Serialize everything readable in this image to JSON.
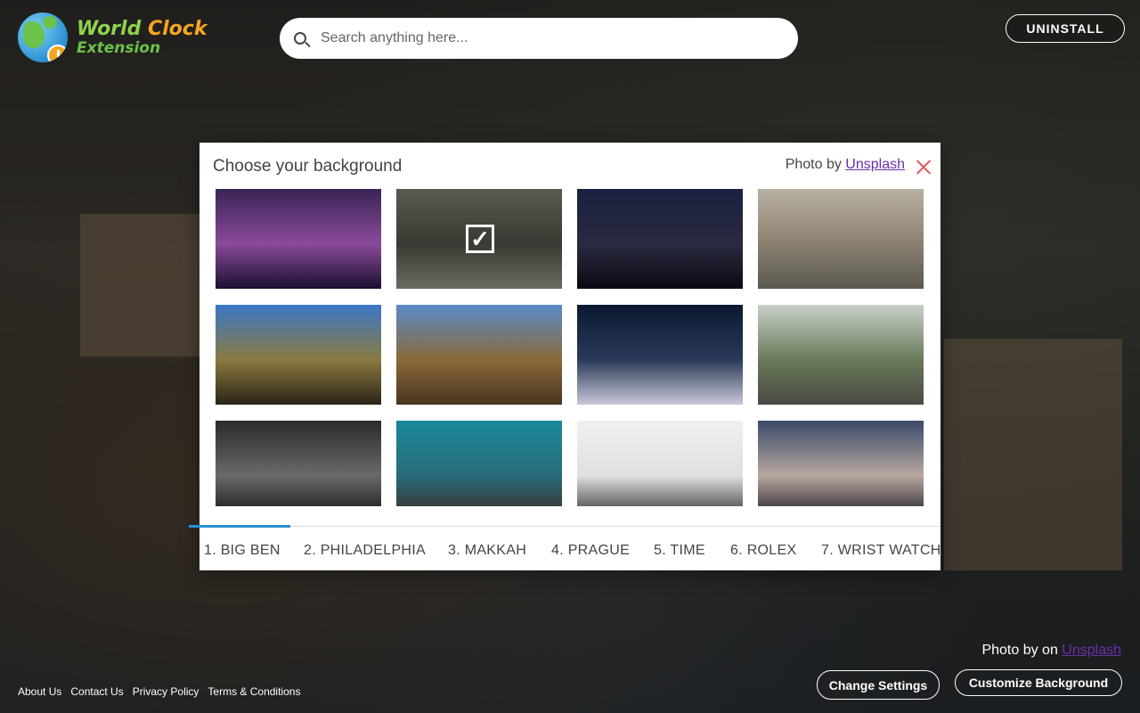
{
  "logo": {
    "line1_a": "World ",
    "line1_b": "Clock",
    "line2": "Extension"
  },
  "search": {
    "placeholder": "Search anything here..."
  },
  "header": {
    "uninstall_label": "UNINSTALL"
  },
  "modal": {
    "title": "Choose your background",
    "photo_by": "Photo by ",
    "photo_source": "Unsplash",
    "selected_index": 1,
    "thumbnails": [
      {
        "colors": [
          "#3a2456",
          "#8a4a9a",
          "#1a1030"
        ]
      },
      {
        "colors": [
          "#5a5a50",
          "#3a3a34",
          "#6a6a60"
        ]
      },
      {
        "colors": [
          "#1a2040",
          "#2a2a40",
          "#0a0a14"
        ]
      },
      {
        "colors": [
          "#b8b0a0",
          "#8a8070",
          "#5a5850"
        ]
      },
      {
        "colors": [
          "#3a78c8",
          "#8a7a40",
          "#2a2418"
        ]
      },
      {
        "colors": [
          "#5a8ac8",
          "#8a6a3a",
          "#4a3420"
        ]
      },
      {
        "colors": [
          "#0a1830",
          "#2a3a58",
          "#c8c8d8"
        ]
      },
      {
        "colors": [
          "#c8d0c8",
          "#6a7a5a",
          "#4a4a44"
        ]
      },
      {
        "colors": [
          "#2a2a2a",
          "#6a6a6a",
          "#111111"
        ]
      },
      {
        "colors": [
          "#1a8a9a",
          "#2a6a7a",
          "#3a2a20"
        ]
      },
      {
        "colors": [
          "#f0f0f0",
          "#e0e0e0",
          "#2a2a2a"
        ]
      },
      {
        "colors": [
          "#3a4a6a",
          "#b8a8a0",
          "#1a1820"
        ]
      }
    ],
    "tabs": [
      {
        "label": "1. BIG BEN"
      },
      {
        "label": "2. PHILADELPHIA"
      },
      {
        "label": "3. MAKKAH"
      },
      {
        "label": "4. PRAGUE"
      },
      {
        "label": "5. TIME"
      },
      {
        "label": "6. ROLEX"
      },
      {
        "label": "7. WRIST WATCH"
      }
    ]
  },
  "bottom": {
    "photo_by": "Photo by on ",
    "photo_source": "Unsplash",
    "change_settings": "Change Settings",
    "customize_background": "Customize Background"
  },
  "footer": {
    "links": [
      "About Us",
      "Contact Us",
      "Privacy Policy",
      "Terms & Conditions"
    ]
  }
}
